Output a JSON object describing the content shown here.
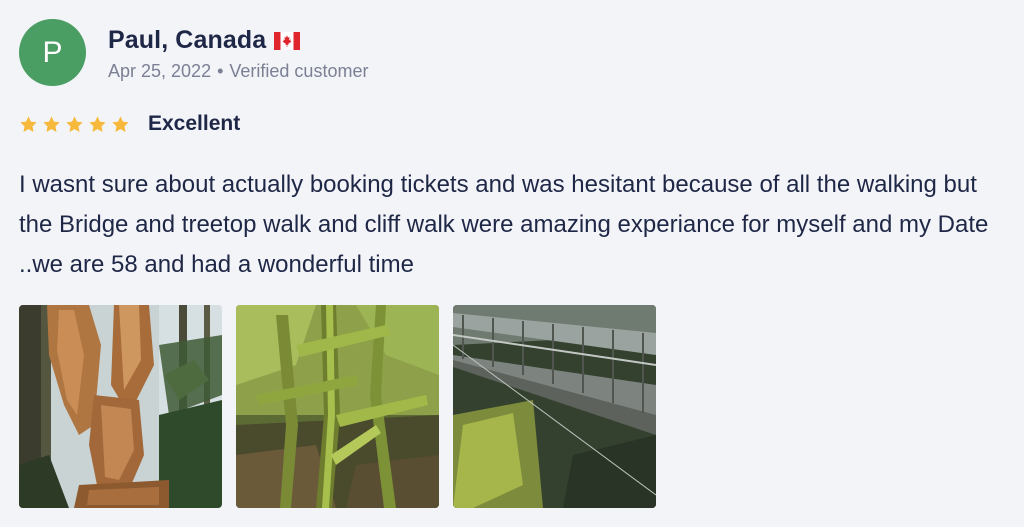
{
  "reviewer": {
    "initial": "P",
    "name": "Paul, Canada",
    "country_flag_icon": "canada-flag-icon",
    "date": "Apr 25, 2022",
    "separator": "•",
    "status": "Verified customer",
    "avatar_color": "#4a9d63"
  },
  "rating": {
    "stars": 5,
    "max_stars": 5,
    "star_color": "#f6b93b",
    "label": "Excellent"
  },
  "review": {
    "text": "I wasnt sure about actually booking tickets and was hesitant because of all the walking but the Bridge and treetop walk and cliff walk were amazing experiance for myself and my Date ..we are 58 and had a wonderful time"
  },
  "photos": [
    {
      "subject": "wooden-eagle-carving-photo"
    },
    {
      "subject": "mossy-trees-forest-photo"
    },
    {
      "subject": "cliffwalk-bridge-photo"
    }
  ]
}
